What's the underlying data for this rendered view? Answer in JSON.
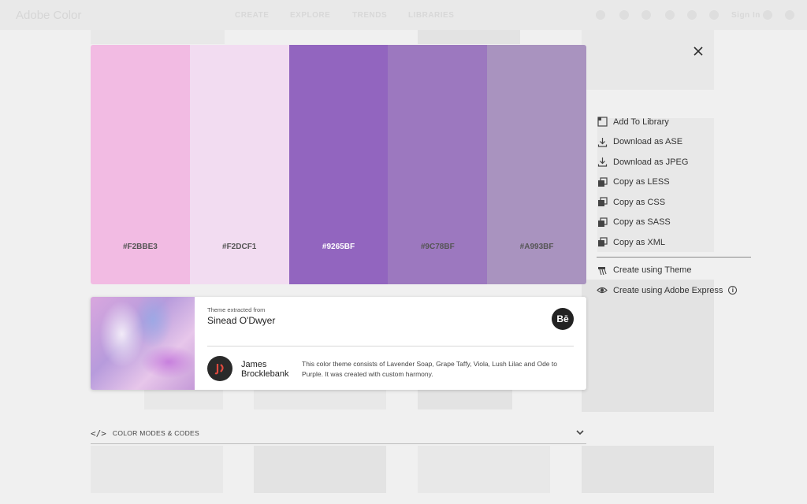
{
  "background": {
    "app_title": "Adobe Color",
    "nav": [
      "CREATE",
      "EXPLORE",
      "TRENDS",
      "LIBRARIES"
    ],
    "sign_in": "Sign In"
  },
  "modal": {
    "close_icon": "close-icon",
    "swatches": [
      {
        "hex": "#F2BBE3",
        "color": "#F2BBE3"
      },
      {
        "hex": "#F2DCF1",
        "color": "#F2DCF1"
      },
      {
        "hex": "#9265BF",
        "color": "#9265BF"
      },
      {
        "hex": "#9C78BF",
        "color": "#9C78BF"
      },
      {
        "hex": "#A993BF",
        "color": "#A993BF"
      }
    ],
    "actions": [
      {
        "label": "Add To Library",
        "icon": "library-icon"
      },
      {
        "label": "Download as ASE",
        "icon": "download-icon"
      },
      {
        "label": "Download as JPEG",
        "icon": "download-icon"
      },
      {
        "label": "Copy as LESS",
        "icon": "copy-icon"
      },
      {
        "label": "Copy as CSS",
        "icon": "copy-icon"
      },
      {
        "label": "Copy as SASS",
        "icon": "copy-icon"
      },
      {
        "label": "Copy as XML",
        "icon": "copy-icon"
      }
    ],
    "secondary_actions": [
      {
        "label": "Create using Theme",
        "icon": "brush-icon"
      },
      {
        "label": "Create using Adobe Express",
        "icon": "eye-icon",
        "info": "i"
      }
    ],
    "theme_card": {
      "extracted_label": "Theme extracted from",
      "author": "Sinead O'Dwyer",
      "behance_label": "Bē",
      "creator": "James Brocklebank",
      "description": "This color theme consists of Lavender Soap, Grape Taffy, Viola, Lush Lilac and Ode to Purple. It was created with custom harmony."
    },
    "color_modes": {
      "icon": "</>",
      "label": "COLOR MODES & CODES"
    }
  }
}
